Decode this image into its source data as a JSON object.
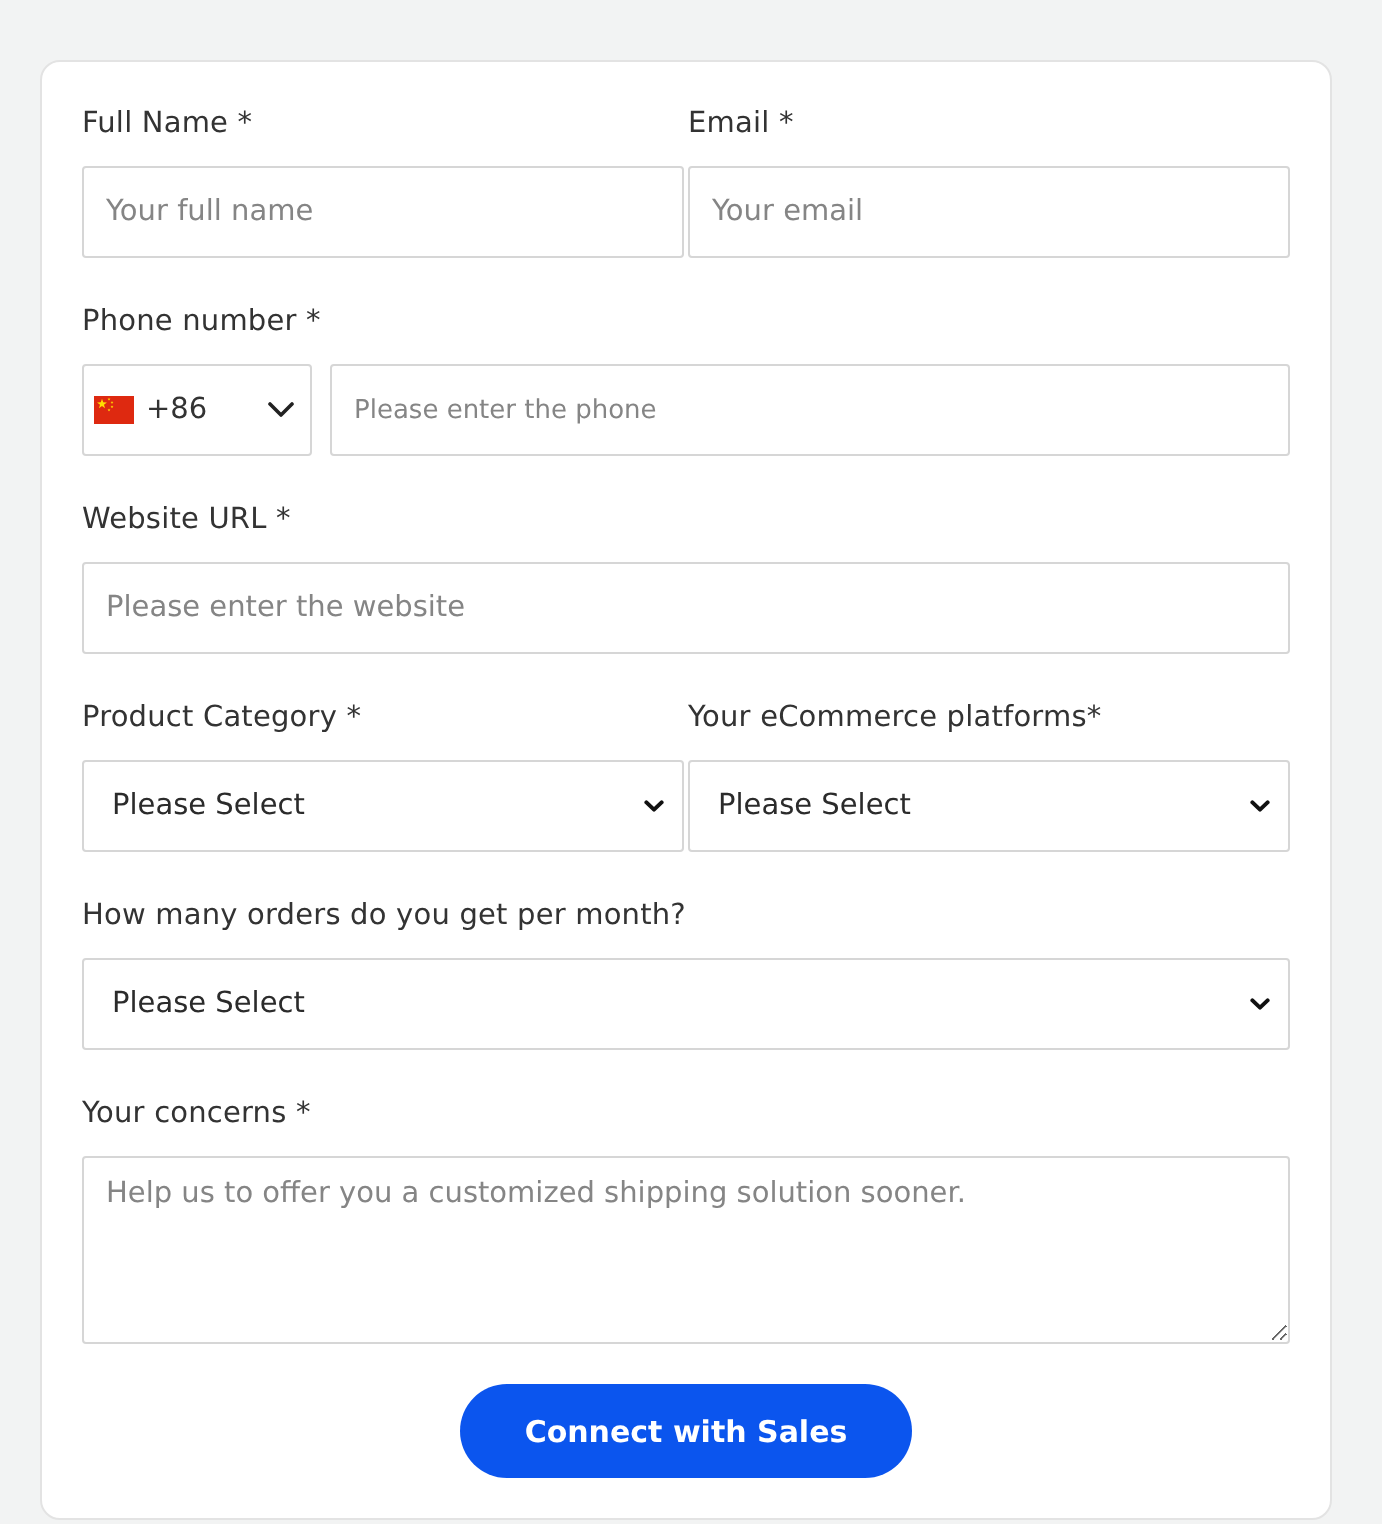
{
  "rows": [
    {
      "fields": [
        {
          "kind": "text",
          "label": "Full Name *",
          "placeholder": "Your full name"
        },
        {
          "kind": "text",
          "label": "Email *",
          "placeholder": "Your email"
        }
      ]
    },
    {
      "fields": [
        {
          "kind": "phone",
          "label": "Phone number *",
          "country_code": "+86",
          "placeholder": "Please enter the phone"
        }
      ]
    },
    {
      "fields": [
        {
          "kind": "text",
          "label": "Website URL *",
          "placeholder": "Please enter the website"
        }
      ]
    },
    {
      "fields": [
        {
          "kind": "select",
          "label": "Product Category *",
          "value": "Please Select"
        },
        {
          "kind": "select",
          "label": "Your eCommerce platforms*",
          "value": "Please Select"
        }
      ]
    },
    {
      "fields": [
        {
          "kind": "select",
          "label": "How many orders do you get per month?",
          "value": "Please Select"
        }
      ]
    },
    {
      "fields": [
        {
          "kind": "textarea",
          "label": "Your concerns *",
          "placeholder": "Help us to offer you a customized shipping solution sooner."
        }
      ]
    }
  ],
  "submit_button": {
    "label": "Connect with Sales"
  }
}
